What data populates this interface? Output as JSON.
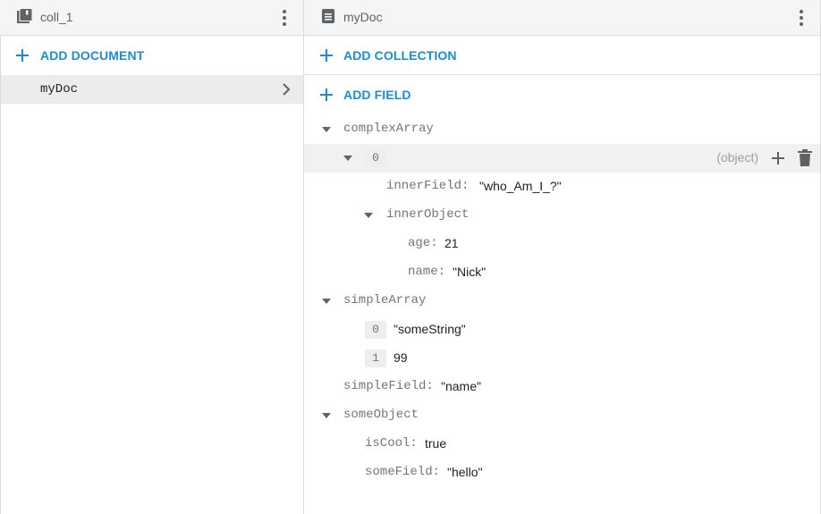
{
  "left_panel": {
    "title": "coll_1",
    "header_icon": "collection-icon",
    "add_document_label": "ADD DOCUMENT",
    "documents": [
      {
        "label": "myDoc",
        "selected": true
      }
    ]
  },
  "right_panel": {
    "title": "myDoc",
    "header_icon": "document-icon",
    "add_collection_label": "ADD COLLECTION",
    "add_field_label": "ADD FIELD",
    "fields": {
      "complexArray": {
        "key": "complexArray",
        "item0": {
          "index": "0",
          "type_hint": "(object)",
          "innerField": {
            "key": "innerField:",
            "value": "\"who_Am_I_?\""
          },
          "innerObject": {
            "key": "innerObject",
            "age": {
              "key": "age:",
              "value": "21"
            },
            "name": {
              "key": "name:",
              "value": "\"Nick\""
            }
          }
        }
      },
      "simpleArray": {
        "key": "simpleArray",
        "items": [
          {
            "index": "0",
            "value": "\"someString\""
          },
          {
            "index": "1",
            "value": "99"
          }
        ]
      },
      "simpleField": {
        "key": "simpleField:",
        "value": "\"name\""
      },
      "someObject": {
        "key": "someObject",
        "isCool": {
          "key": "isCool:",
          "value": "true"
        },
        "someField": {
          "key": "someField:",
          "value": "\"hello\""
        }
      }
    }
  },
  "colors": {
    "accent": "#1a8dd6",
    "key_text": "#757575",
    "selected_bg": "#ececec",
    "header_bg": "#f5f5f5"
  }
}
